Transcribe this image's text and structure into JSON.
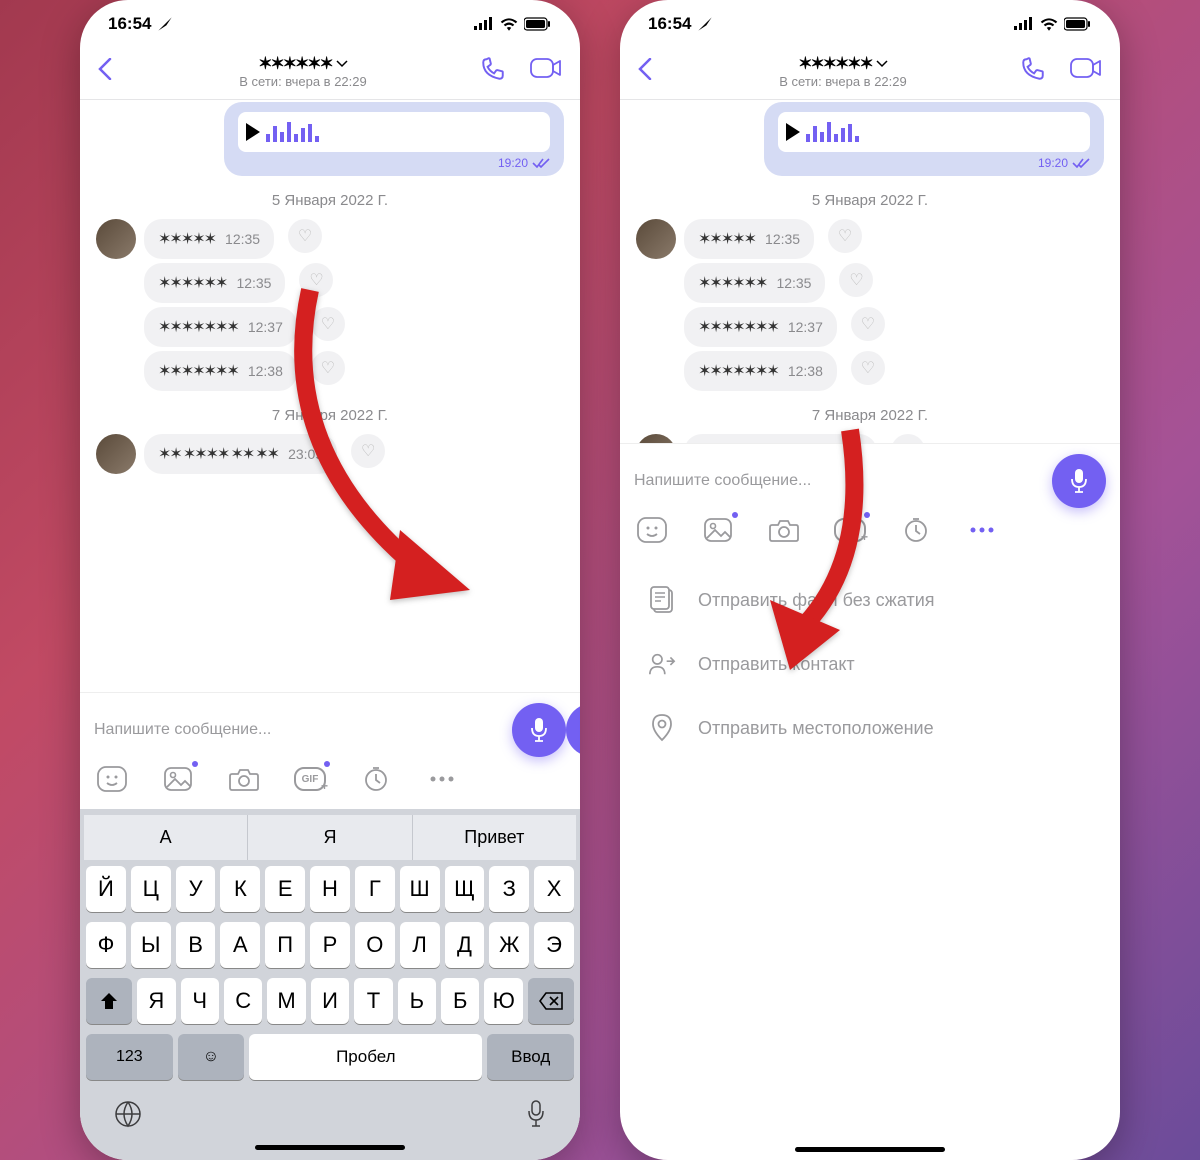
{
  "statusbar": {
    "time": "16:54"
  },
  "header": {
    "last_seen": "В сети: вчера в 22:29"
  },
  "chat": {
    "out_time": "19:20",
    "date1": "5 Января 2022 Г.",
    "in1_time": "12:35",
    "in2_time": "12:35",
    "in3_time": "12:37",
    "in4_time": "12:38",
    "date2": "7 Января 2022 Г.",
    "in5_time": "23:09"
  },
  "composer": {
    "placeholder": "Напишите сообщение..."
  },
  "keyboard": {
    "suggest1": "А",
    "suggest2": "Я",
    "suggest3": "Привет",
    "row1": [
      "Й",
      "Ц",
      "У",
      "К",
      "Е",
      "Н",
      "Г",
      "Ш",
      "Щ",
      "З",
      "Х"
    ],
    "row2": [
      "Ф",
      "Ы",
      "В",
      "А",
      "П",
      "Р",
      "О",
      "Л",
      "Д",
      "Ж",
      "Э"
    ],
    "row3": [
      "Я",
      "Ч",
      "С",
      "М",
      "И",
      "Т",
      "Ь",
      "Б",
      "Ю"
    ],
    "num_label": "123",
    "space_label": "Пробел",
    "enter_label": "Ввод"
  },
  "more_menu": {
    "send_file": "Отправить файл без сжатия",
    "send_contact": "Отправить контакт",
    "send_location": "Отправить местоположение"
  }
}
